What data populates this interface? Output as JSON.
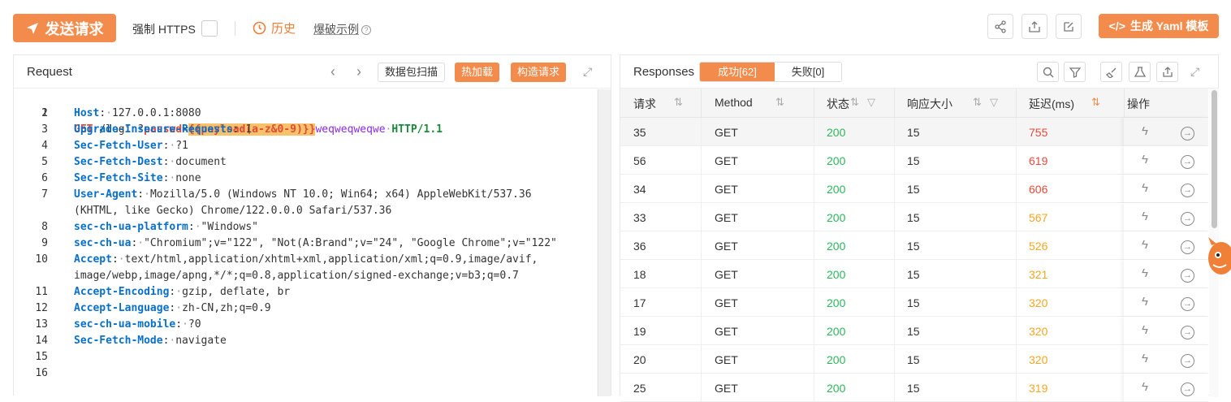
{
  "toolbar": {
    "send_label": "发送请求",
    "https_label": "强制 HTTPS",
    "history_label": "历史",
    "example_label": "爆破示例",
    "yaml_label": "生成 Yaml 模板",
    "icons": [
      "share-icon",
      "export-icon",
      "edit-icon"
    ]
  },
  "request": {
    "title": "Request",
    "scan_label": "数据包扫描",
    "hotload_label": "热加载",
    "build_label": "构造请求",
    "lines": [
      {
        "n": "1"
      },
      {
        "n": "2",
        "name": "Host",
        "val": "127.0.0.1:8080"
      },
      {
        "n": "3",
        "name": "Upgrade-Insecure-Requests",
        "val": "1"
      },
      {
        "n": "4",
        "name": "Sec-Fetch-User",
        "val": "?1"
      },
      {
        "n": "5",
        "name": "Sec-Fetch-Dest",
        "val": "document"
      },
      {
        "n": "6",
        "name": "Sec-Fetch-Site",
        "val": "none"
      },
      {
        "n": "7",
        "name": "User-Agent",
        "val": "Mozilla/5.0 (Windows NT 10.0; Win64; x64) AppleWebKit/537.36",
        "cont": "(KHTML, like Gecko) Chrome/122.0.0.0 Safari/537.36"
      },
      {
        "n": "8",
        "name": "sec-ch-ua-platform",
        "val": "\"Windows\""
      },
      {
        "n": "9",
        "name": "sec-ch-ua",
        "val": "\"Chromium\";v=\"122\", \"Not(A:Brand\";v=\"24\", \"Google Chrome\";v=\"122\""
      },
      {
        "n": "10",
        "name": "Accept",
        "val": "text/html,application/xhtml+xml,application/xml;q=0.9,image/avif,",
        "cont": "image/webp,image/apng,*/*;q=0.8,application/signed-exchange;v=b3;q=0.7"
      },
      {
        "n": "11",
        "name": "Accept-Encoding",
        "val": "gzip, deflate, br"
      },
      {
        "n": "12",
        "name": "Accept-Language",
        "val": "zh-CN,zh;q=0.9"
      },
      {
        "n": "13",
        "name": "sec-ch-ua-mobile",
        "val": "?0"
      },
      {
        "n": "14",
        "name": "Sec-Fetch-Mode",
        "val": "navigate"
      },
      {
        "n": "15"
      },
      {
        "n": "16"
      }
    ],
    "line1": {
      "method": "GET",
      "path": "/login?",
      "param": "passwd",
      "eq": "=",
      "payload": "{{payload(a-z&0-9)}}",
      "suffix": "weqweqweqwe",
      "proto": "HTTP/1.1"
    }
  },
  "responses": {
    "title": "Responses",
    "success_tab": "成功[62]",
    "fail_tab": "失败[0]",
    "columns": [
      "请求",
      "Method",
      "状态",
      "响应大小",
      "延迟(ms)",
      "操作"
    ],
    "rows": [
      {
        "id": "35",
        "method": "GET",
        "status": "200",
        "size": "15",
        "delay": "755",
        "delay_color": "#e04b3a"
      },
      {
        "id": "56",
        "method": "GET",
        "status": "200",
        "size": "15",
        "delay": "619",
        "delay_color": "#e04b3a"
      },
      {
        "id": "34",
        "method": "GET",
        "status": "200",
        "size": "15",
        "delay": "606",
        "delay_color": "#e04b3a"
      },
      {
        "id": "33",
        "method": "GET",
        "status": "200",
        "size": "15",
        "delay": "567",
        "delay_color": "#f5a623"
      },
      {
        "id": "36",
        "method": "GET",
        "status": "200",
        "size": "15",
        "delay": "526",
        "delay_color": "#f5a623"
      },
      {
        "id": "18",
        "method": "GET",
        "status": "200",
        "size": "15",
        "delay": "321",
        "delay_color": "#f5a623"
      },
      {
        "id": "17",
        "method": "GET",
        "status": "200",
        "size": "15",
        "delay": "320",
        "delay_color": "#f5a623"
      },
      {
        "id": "19",
        "method": "GET",
        "status": "200",
        "size": "15",
        "delay": "320",
        "delay_color": "#f5a623"
      },
      {
        "id": "20",
        "method": "GET",
        "status": "200",
        "size": "15",
        "delay": "320",
        "delay_color": "#f5a623"
      },
      {
        "id": "25",
        "method": "GET",
        "status": "200",
        "size": "15",
        "delay": "319",
        "delay_color": "#f5a623"
      }
    ],
    "status_color": "#2db55d"
  }
}
